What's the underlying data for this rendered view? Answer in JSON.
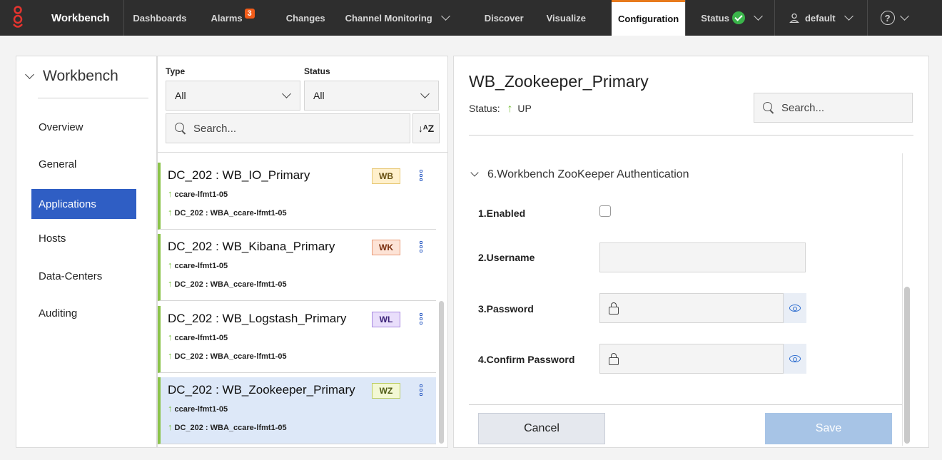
{
  "nav": {
    "brand": "Workbench",
    "dashboards": "Dashboards",
    "alarms": "Alarms",
    "alarms_count": "3",
    "changes": "Changes",
    "channel_monitoring": "Channel Monitoring",
    "discover": "Discover",
    "visualize": "Visualize",
    "configuration": "Configuration",
    "status": "Status",
    "user": "default",
    "help": "?"
  },
  "sidebar": {
    "title": "Workbench",
    "items": [
      {
        "label": "Overview"
      },
      {
        "label": "General"
      },
      {
        "label": "Applications"
      },
      {
        "label": "Hosts"
      },
      {
        "label": "Data-Centers"
      },
      {
        "label": "Auditing"
      }
    ]
  },
  "filters": {
    "type_label": "Type",
    "type_value": "All",
    "status_label": "Status",
    "status_value": "All",
    "search_placeholder": "Search...",
    "sort_label": "↓ᴬZ"
  },
  "apps": [
    {
      "title": "DC_202 : WB_IO_Primary",
      "tag": "WB",
      "host": "ccare-lfmt1-05",
      "dc": "DC_202 : WBA_ccare-lfmt1-05"
    },
    {
      "title": "DC_202 : WB_Kibana_Primary",
      "tag": "WK",
      "host": "ccare-lfmt1-05",
      "dc": "DC_202 : WBA_ccare-lfmt1-05"
    },
    {
      "title": "DC_202 : WB_Logstash_Primary",
      "tag": "WL",
      "host": "ccare-lfmt1-05",
      "dc": "DC_202 : WBA_ccare-lfmt1-05"
    },
    {
      "title": "DC_202 : WB_Zookeeper_Primary",
      "tag": "WZ",
      "host": "ccare-lfmt1-05",
      "dc": "DC_202 : WBA_ccare-lfmt1-05"
    }
  ],
  "detail": {
    "title": "WB_Zookeeper_Primary",
    "status_label": "Status:",
    "status_value": "UP",
    "search_placeholder": "Search...",
    "section": "6.Workbench ZooKeeper Authentication",
    "fields": {
      "enabled": "1.Enabled",
      "username": "2.Username",
      "password": "3.Password",
      "confirm": "4.Confirm Password"
    },
    "cancel": "Cancel",
    "save": "Save"
  },
  "colors": {
    "accent": "#2f5ec4",
    "up": "#7cc240",
    "alarm": "#f25c19",
    "tab_active": "#e87a1c"
  }
}
